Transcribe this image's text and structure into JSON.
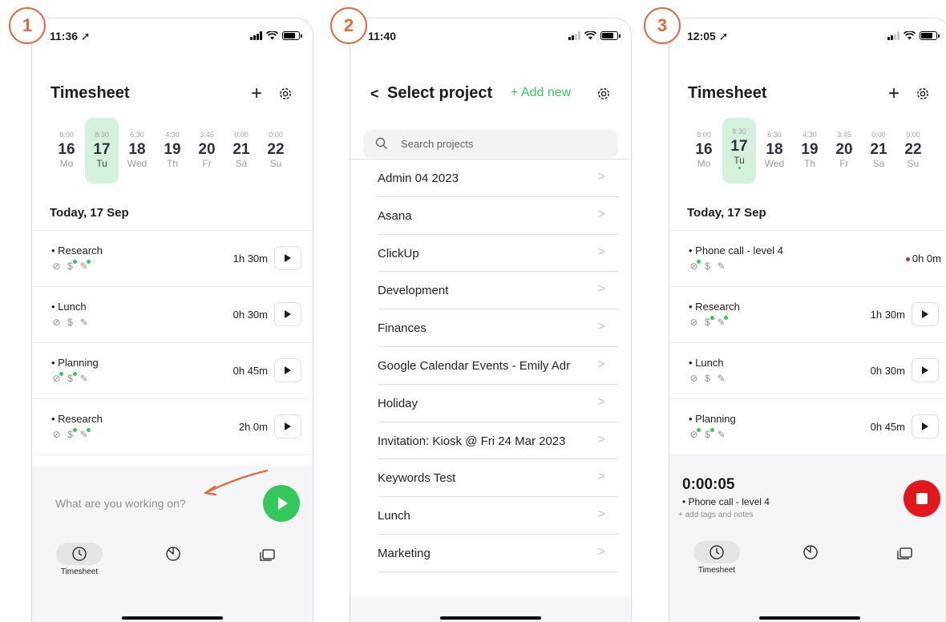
{
  "badges": [
    "1",
    "2",
    "3"
  ],
  "accent": "#34c759",
  "stop_color": "#e2171b",
  "badge_color": "#e8663b",
  "phone1": {
    "status_time": "11:36 ➚",
    "title": "Timesheet",
    "plus": "+",
    "days": [
      {
        "hrs": "8:00",
        "num": "16",
        "wd": "Mo"
      },
      {
        "hrs": "8:30",
        "num": "17",
        "wd": "Tu"
      },
      {
        "hrs": "6:30",
        "num": "18",
        "wd": "Wed"
      },
      {
        "hrs": "4:30",
        "num": "19",
        "wd": "Th"
      },
      {
        "hrs": "3:45",
        "num": "20",
        "wd": "Fr"
      },
      {
        "hrs": "0:00",
        "num": "21",
        "wd": "Sa"
      },
      {
        "hrs": "0:00",
        "num": "22",
        "wd": "Su"
      }
    ],
    "today": "Today, 17 Sep",
    "entries": [
      {
        "name": "• Research",
        "dur": "1h 30m"
      },
      {
        "name": "• Lunch",
        "dur": "0h 30m"
      },
      {
        "name": "• Planning",
        "dur": "0h 45m"
      },
      {
        "name": "• Research",
        "dur": "2h 0m"
      }
    ],
    "placeholder": "What are you working on?",
    "tab_timesheet": "Timesheet"
  },
  "phone2": {
    "status_time": "11:40",
    "back": "<",
    "title": "Select project",
    "add_new": "+ Add new",
    "search_placeholder": "Search projects",
    "projects": [
      "Admin 04 2023",
      "Asana",
      "ClickUp",
      "Development",
      "Finances",
      "Google Calendar Events - Emily Adr",
      "Holiday",
      "Invitation: Kiosk @ Fri 24 Mar 2023",
      "Keywords Test",
      "Lunch",
      "Marketing"
    ],
    "chevron": ">"
  },
  "phone3": {
    "status_time": "12:05 ➚",
    "title": "Timesheet",
    "plus": "+",
    "days": [
      {
        "hrs": "8:00",
        "num": "16",
        "wd": "Mo"
      },
      {
        "hrs": "8:30",
        "num": "17",
        "wd": "Tu"
      },
      {
        "hrs": "6:30",
        "num": "18",
        "wd": "Wed"
      },
      {
        "hrs": "4:30",
        "num": "19",
        "wd": "Th"
      },
      {
        "hrs": "3:45",
        "num": "20",
        "wd": "Fr"
      },
      {
        "hrs": "0:00",
        "num": "21",
        "wd": "Sa"
      },
      {
        "hrs": "0:00",
        "num": "22",
        "wd": "Su"
      }
    ],
    "today": "Today, 17 Sep",
    "entries": [
      {
        "name": "• Phone call - level 4",
        "dur": "0h 0m"
      },
      {
        "name": "• Research",
        "dur": "1h 30m"
      },
      {
        "name": "• Lunch",
        "dur": "0h 30m"
      },
      {
        "name": "• Planning",
        "dur": "0h 45m"
      }
    ],
    "timer": "0:00:05",
    "timer_task": "• Phone call - level 4",
    "timer_notes": "+ add tags and notes",
    "tab_timesheet": "Timesheet"
  }
}
